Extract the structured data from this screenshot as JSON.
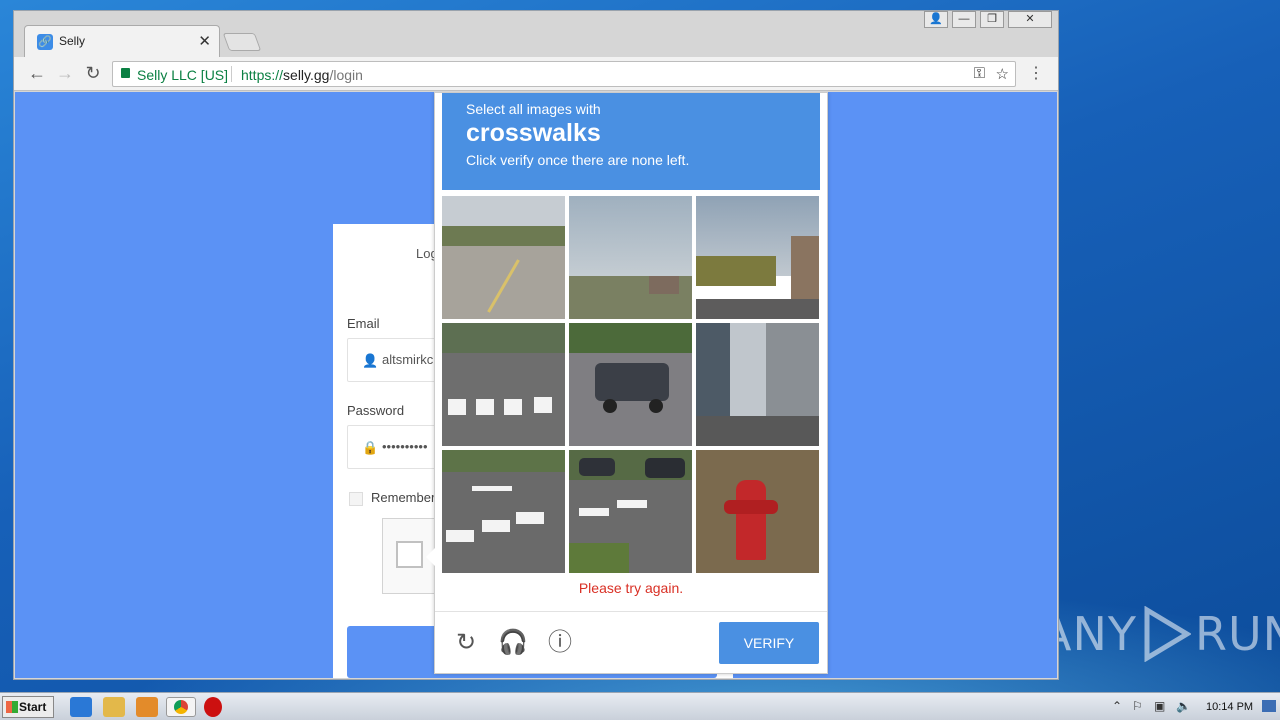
{
  "browser": {
    "tab_title": "Selly",
    "tab_close": "✕",
    "security_label": "Selly LLC [US]",
    "url_scheme": "https://",
    "url_host": "selly.gg",
    "url_path": "/login",
    "icons": [
      "back-icon",
      "forward-icon",
      "reload-icon",
      "key-icon",
      "star-icon",
      "menu-icon"
    ]
  },
  "login_form": {
    "heading": "Log",
    "email_label": "Email",
    "email_value": "altsmirkc",
    "password_label": "Password",
    "password_value": "••••••••••",
    "remember_label": "Remember"
  },
  "captcha": {
    "instruction_line1": "Select all images with",
    "keyword": "crosswalks",
    "instruction_line2": "Click verify once there are none left.",
    "error": "Please try again.",
    "verify_label": "VERIFY",
    "tiles": [
      "street",
      "field",
      "street",
      "crosswalk",
      "pickup-truck",
      "city-street",
      "crosswalk",
      "crosswalk",
      "fire-hydrant"
    ],
    "header_color": "#4a90e2",
    "error_color": "#d93025"
  },
  "taskbar": {
    "start_label": "Start",
    "clock": "10:14 PM"
  },
  "watermark": {
    "text_left": "ANY",
    "text_right": "RUN"
  }
}
